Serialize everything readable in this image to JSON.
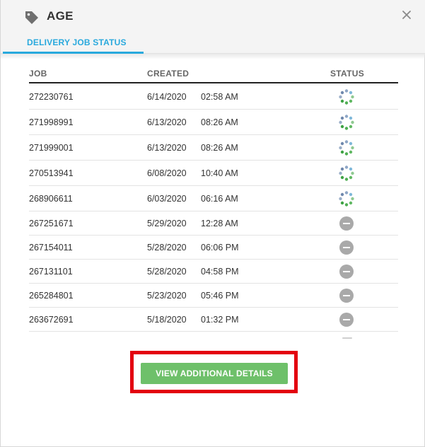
{
  "dialog": {
    "title": "AGE",
    "tag_icon": "tag-icon",
    "close_icon": "close-icon",
    "tab_label": "DELIVERY JOB STATUS",
    "accent_color": "#29a9dd"
  },
  "table": {
    "headers": {
      "job": "JOB",
      "created": "CREATED",
      "status": "STATUS"
    },
    "rows": [
      {
        "job": "272230761",
        "date": "6/14/2020",
        "time": "02:58 AM",
        "status": "in-progress"
      },
      {
        "job": "271998991",
        "date": "6/13/2020",
        "time": "08:26 AM",
        "status": "in-progress"
      },
      {
        "job": "271999001",
        "date": "6/13/2020",
        "time": "08:26 AM",
        "status": "in-progress"
      },
      {
        "job": "270513941",
        "date": "6/08/2020",
        "time": "10:40 AM",
        "status": "in-progress"
      },
      {
        "job": "268906611",
        "date": "6/03/2020",
        "time": "06:16 AM",
        "status": "in-progress"
      },
      {
        "job": "267251671",
        "date": "5/29/2020",
        "time": "12:28 AM",
        "status": "blocked"
      },
      {
        "job": "267154011",
        "date": "5/28/2020",
        "time": "06:06 PM",
        "status": "blocked"
      },
      {
        "job": "267131101",
        "date": "5/28/2020",
        "time": "04:58 PM",
        "status": "blocked"
      },
      {
        "job": "265284801",
        "date": "5/23/2020",
        "time": "05:46 PM",
        "status": "blocked"
      },
      {
        "job": "263672691",
        "date": "5/18/2020",
        "time": "01:32 PM",
        "status": "blocked"
      }
    ]
  },
  "actions": {
    "view_details_label": "VIEW ADDITIONAL DETAILS",
    "button_color": "#6ec06a",
    "highlight_color": "#e3000f"
  }
}
